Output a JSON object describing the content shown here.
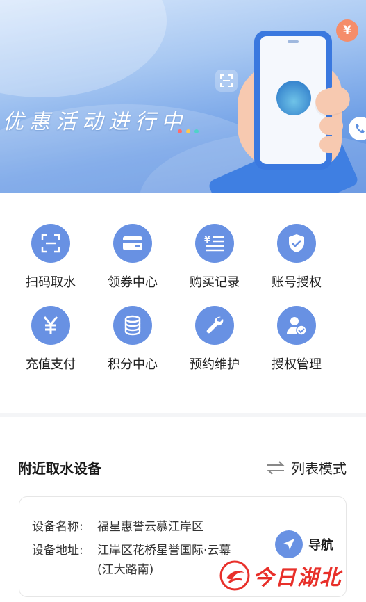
{
  "banner": {
    "title": "优惠活动进行中",
    "coin_symbol": "¥",
    "dot_colors": [
      "#ff6b6b",
      "#ffc94d",
      "#4fd3c9"
    ]
  },
  "grid": {
    "items": [
      {
        "label": "扫码取水",
        "icon": "scan-icon"
      },
      {
        "label": "领券中心",
        "icon": "card-icon"
      },
      {
        "label": "购买记录",
        "icon": "receipt-icon"
      },
      {
        "label": "账号授权",
        "icon": "shield-check-icon"
      },
      {
        "label": "充值支付",
        "icon": "yuan-icon"
      },
      {
        "label": "积分中心",
        "icon": "coins-icon"
      },
      {
        "label": "预约维护",
        "icon": "wrench-icon"
      },
      {
        "label": "授权管理",
        "icon": "user-check-icon"
      }
    ]
  },
  "nearby": {
    "title": "附近取水设备",
    "list_mode_label": "列表模式",
    "device": {
      "name_key": "设备名称:",
      "name_value": "福星惠誉云慕江岸区",
      "address_key": "设备地址:",
      "address_value": "江岸区花桥星誉国际·云幕",
      "address_value_line2": "(江大路南)",
      "nav_label": "导航"
    }
  },
  "watermark": {
    "text": "今日湖北"
  },
  "colors": {
    "accent": "#6891e3",
    "banner_blue": "#5b8ee0",
    "watermark_red": "#e8302a"
  }
}
